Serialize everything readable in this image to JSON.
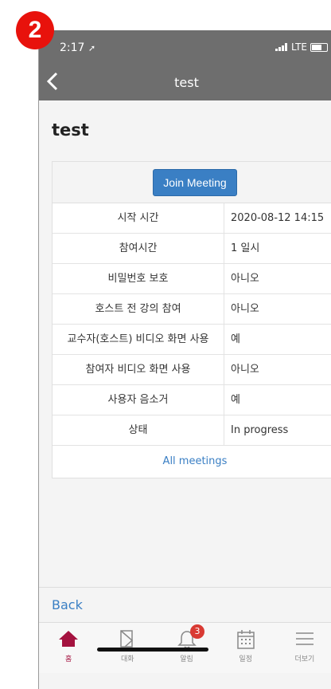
{
  "step_badge": "2",
  "status_bar": {
    "time": "2:17",
    "network": "LTE"
  },
  "nav": {
    "title": "test"
  },
  "page_title": "test",
  "join_label": "Join Meeting",
  "rows": [
    {
      "label": "시작 시간",
      "value": "2020-08-12 14:15"
    },
    {
      "label": "참여시간",
      "value": "1 일시"
    },
    {
      "label": "비밀번호 보호",
      "value": "아니오"
    },
    {
      "label": "호스트 전 강의 참여",
      "value": "아니오"
    },
    {
      "label": "교수자(호스트) 비디오 화면 사용",
      "value": "예"
    },
    {
      "label": "참여자 비디오 화면 사용",
      "value": "아니오"
    },
    {
      "label": "사용자 음소거",
      "value": "예"
    },
    {
      "label": "상태",
      "value": "In progress"
    }
  ],
  "all_meetings": "All meetings",
  "back_label": "Back",
  "tabs": [
    {
      "label": "홈",
      "icon": "home-icon"
    },
    {
      "label": "대화",
      "icon": "chat-icon"
    },
    {
      "label": "알림",
      "icon": "bell-icon",
      "badge": "3"
    },
    {
      "label": "일정",
      "icon": "calendar-icon"
    },
    {
      "label": "더보기",
      "icon": "menu-icon"
    }
  ],
  "colors": {
    "accent": "#3a7fc4",
    "active_tab": "#a4123f",
    "nav_bg": "#6e6e6e",
    "badge": "#d93a33"
  }
}
